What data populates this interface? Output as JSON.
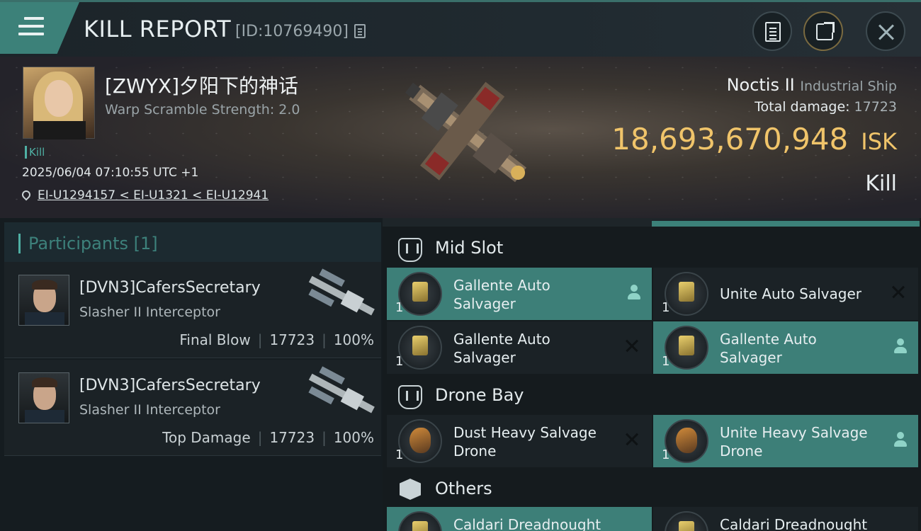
{
  "topbar": {
    "title": "KILL REPORT",
    "report_id": "[ID:10769490]"
  },
  "victim": {
    "name": "[ZWYX]夕阳下的神话",
    "subtitle": "Warp Scramble Strength: 2.0",
    "kill_tag": "Kill",
    "time": "2025/06/04 07:10:55 UTC +1",
    "location": "EI-U1294157 < EI-U1321 < EI-U12941",
    "ship_name": "Noctis II",
    "ship_class": "Industrial Ship",
    "total_damage_label": "Total damage:",
    "total_damage": "17723",
    "isk_value": "18,693,670,948",
    "isk_unit": "ISK",
    "kill_type": "Kill"
  },
  "participants": {
    "heading": "Participants",
    "count": "[1]",
    "rows": [
      {
        "name": "[DVN3]CafersSecretary",
        "ship": "Slasher II Interceptor",
        "role": "Final Blow",
        "damage": "17723",
        "percent": "100%"
      },
      {
        "name": "[DVN3]CafersSecretary",
        "ship": "Slasher II Interceptor",
        "role": "Top Damage",
        "damage": "17723",
        "percent": "100%"
      }
    ]
  },
  "sections": {
    "mid_slot": {
      "label": "Mid Slot",
      "items": [
        {
          "qty": "1",
          "name": "Gallente Auto Salvager",
          "status": "dropped"
        },
        {
          "qty": "1",
          "name": "Unite Auto Salvager",
          "status": "destroyed"
        },
        {
          "qty": "1",
          "name": "Gallente Auto Salvager",
          "status": "destroyed"
        },
        {
          "qty": "1",
          "name": "Gallente Auto Salvager",
          "status": "dropped"
        }
      ]
    },
    "drone_bay": {
      "label": "Drone Bay",
      "items": [
        {
          "qty": "1",
          "name": "Dust Heavy Salvage Drone",
          "status": "destroyed"
        },
        {
          "qty": "1",
          "name": "Unite Heavy Salvage Drone",
          "status": "dropped"
        }
      ]
    },
    "others": {
      "label": "Others",
      "items": [
        {
          "name": "Caldari Dreadnought"
        },
        {
          "name": "Caldari Dreadnought"
        }
      ]
    }
  },
  "colors": {
    "accent_teal": "#3d7f78",
    "isk_gold": "#f0c46a"
  }
}
